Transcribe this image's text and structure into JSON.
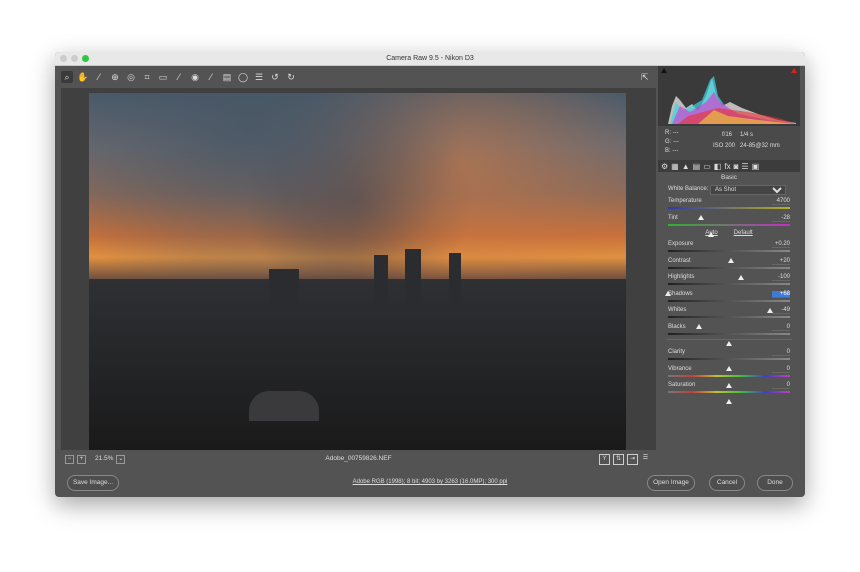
{
  "window": {
    "title": "Camera Raw 9.5  -  Nikon D3"
  },
  "toolbar": {
    "tools": [
      "zoom-icon",
      "hand-icon",
      "white-balance-icon",
      "color-sampler-icon",
      "targeted-adjustment-icon",
      "crop-icon",
      "straighten-icon",
      "spot-removal-icon",
      "red-eye-icon",
      "adjustment-brush-icon",
      "graduated-filter-icon",
      "radial-filter-icon",
      "preferences-icon",
      "rotate-ccw-icon",
      "rotate-cw-icon"
    ],
    "glyphs": [
      "⌕",
      "✋",
      "⁄",
      "⊕",
      "◎",
      "⌗",
      "▭",
      "⁄",
      "◉",
      "⁄",
      "▤",
      "◯",
      "☰",
      "↺",
      "↻"
    ]
  },
  "stage": {
    "zoom": "21.5%",
    "filename": "Adobe_00759826.NEF"
  },
  "info": {
    "r_label": "R:",
    "g_label": "G:",
    "b_label": "B:",
    "r": "---",
    "g": "---",
    "b": "---",
    "aperture": "f/16",
    "shutter": "1/4 s",
    "iso": "ISO 200",
    "lens": "24-85@32 mm"
  },
  "panel": {
    "section": "Basic",
    "white_balance_label": "White Balance:",
    "white_balance": "As Shot",
    "auto": "Auto",
    "default": "Default",
    "sliders": [
      {
        "label": "Temperature",
        "value": "4700",
        "position": 27,
        "track": "temp"
      },
      {
        "label": "Tint",
        "value": "-28",
        "position": 35,
        "track": "tint"
      },
      {
        "label": "Exposure",
        "value": "+0.20",
        "position": 52,
        "track": "gray"
      },
      {
        "label": "Contrast",
        "value": "+20",
        "position": 60,
        "track": "gray"
      },
      {
        "label": "Highlights",
        "value": "-100",
        "position": 0,
        "track": "gray"
      },
      {
        "label": "Shadows",
        "value": "+68",
        "position": 84,
        "track": "gray",
        "highlight": true
      },
      {
        "label": "Whites",
        "value": "-49",
        "position": 25,
        "track": "gray"
      },
      {
        "label": "Blacks",
        "value": "0",
        "position": 50,
        "track": "gray"
      },
      {
        "label": "Clarity",
        "value": "0",
        "position": 50,
        "track": "gray"
      },
      {
        "label": "Vibrance",
        "value": "0",
        "position": 50,
        "track": "rainbow"
      },
      {
        "label": "Saturation",
        "value": "0",
        "position": 50,
        "track": "rainbow"
      }
    ]
  },
  "footer": {
    "save": "Save Image...",
    "workflow": "Adobe RGB (1998); 8 bit; 4903 by 3263 (16.0MP); 300 ppi",
    "open": "Open Image",
    "cancel": "Cancel",
    "done": "Done"
  }
}
